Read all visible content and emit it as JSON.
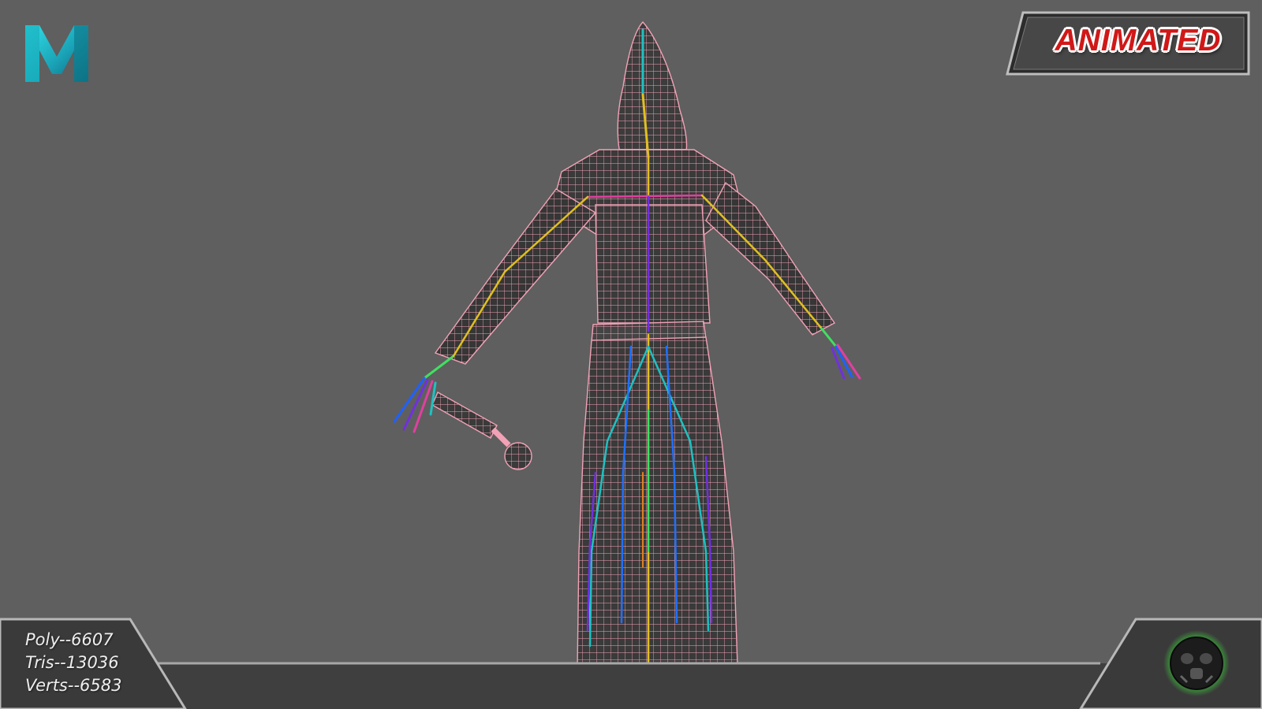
{
  "badge": {
    "label": "ANIMATED"
  },
  "stats": {
    "poly": "Poly--6607",
    "tris": "Tris--13036",
    "verts": "Verts--6583"
  },
  "icons": {
    "app_logo": "maya-logo-icon",
    "brand_logo": "gas-mask-logo-icon"
  },
  "colors": {
    "background": "#5f5f5f",
    "wireframe": "#f2a2b6",
    "badge_text": "#d01818",
    "brand_glow": "#3cff3c",
    "bones": [
      "#20c0c0",
      "#e0c020",
      "#7030e0",
      "#4050e0",
      "#40e060",
      "#e040a0"
    ]
  }
}
